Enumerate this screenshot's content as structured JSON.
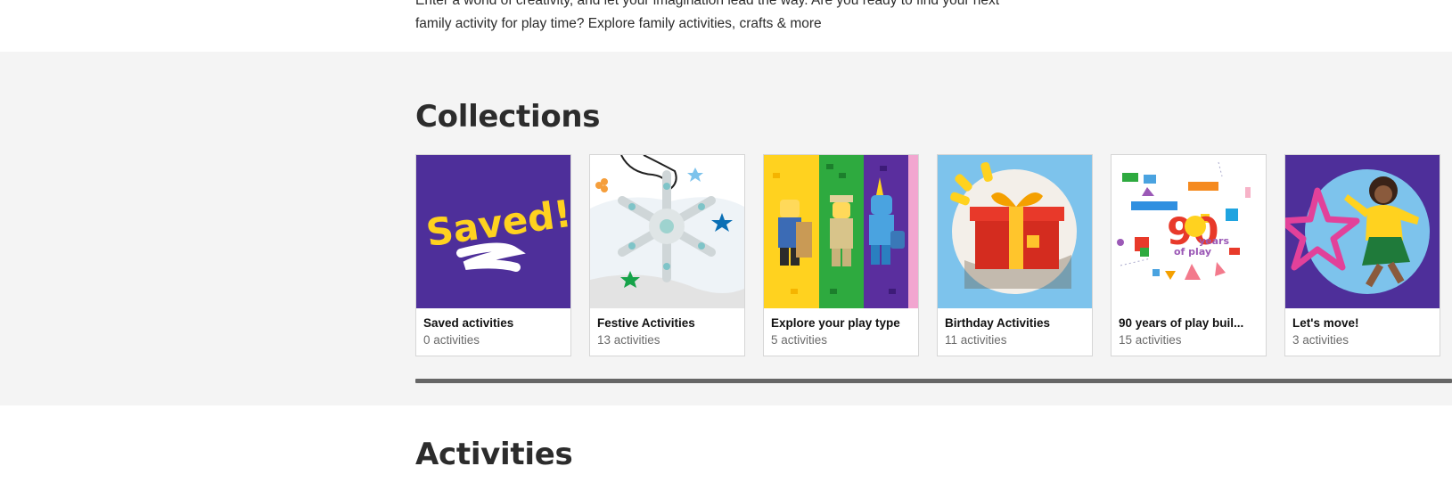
{
  "intro": {
    "line1": "Enter a world of creativity, and let your imagination lead the way. Are you ready to find your next",
    "line2": "family activity for play time? Explore family activities, crafts & more"
  },
  "collections": {
    "title": "Collections",
    "cards": [
      {
        "title": "Saved activities",
        "count": "0 activities",
        "thumb_text": "Saved!",
        "icon": "saved-thumbnail"
      },
      {
        "title": "Festive Activities",
        "count": "13 activities",
        "icon": "snowflake-thumbnail"
      },
      {
        "title": "Explore your play type",
        "count": "5 activities",
        "icon": "minifigures-thumbnail"
      },
      {
        "title": "Birthday Activities",
        "count": "11 activities",
        "icon": "gift-thumbnail"
      },
      {
        "title": "90 years of play buil...",
        "count": "15 activities",
        "thumb_text_big": "90",
        "thumb_text_small1": "years",
        "thumb_text_small2": "of play",
        "icon": "ninety-years-thumbnail"
      },
      {
        "title": "Let's move!",
        "count": "3 activities",
        "icon": "jumping-girl-thumbnail"
      }
    ]
  },
  "activities": {
    "title": "Activities"
  },
  "colors": {
    "purple": "#4e2f9a",
    "yellow": "#ffd21f",
    "sky": "#7dc3ec",
    "section_bg": "#f4f4f4",
    "scrollbar": "#666666"
  }
}
